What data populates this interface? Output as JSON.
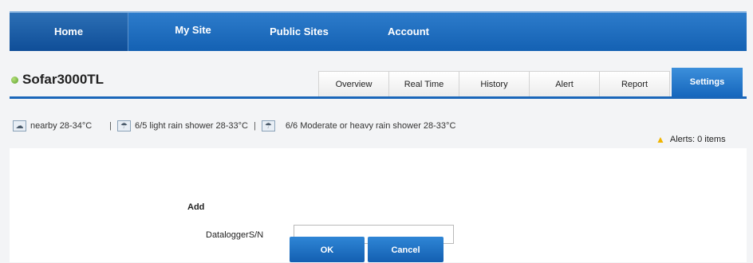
{
  "nav": {
    "items": [
      "Home",
      "My Site",
      "Public Sites",
      "Account"
    ]
  },
  "device": {
    "name": "Sofar3000TL",
    "status_color": "#5aa02c"
  },
  "tabs": [
    "Overview",
    "Real Time",
    "History",
    "Alert",
    "Report",
    "Settings"
  ],
  "active_tab": "Settings",
  "weather": {
    "items": [
      {
        "icon": "cloud-icon",
        "text": "nearby 28-34°C"
      },
      {
        "icon": "rain-cloud-icon",
        "text": "6/5 light rain shower 28-33°C"
      },
      {
        "icon": "rain-cloud-icon",
        "text": "6/6 Moderate or heavy rain shower 28-33°C"
      }
    ],
    "separator": "|"
  },
  "alerts": {
    "icon": "warning-icon",
    "text": "Alerts: 0 items"
  },
  "form": {
    "section_label": "Add",
    "field_label": "DataloggerS/N",
    "field_value": "",
    "ok_label": "OK",
    "cancel_label": "Cancel"
  },
  "colors": {
    "nav_blue": "#1461b3",
    "accent": "#1a66b9",
    "warning": "#f0b400"
  }
}
